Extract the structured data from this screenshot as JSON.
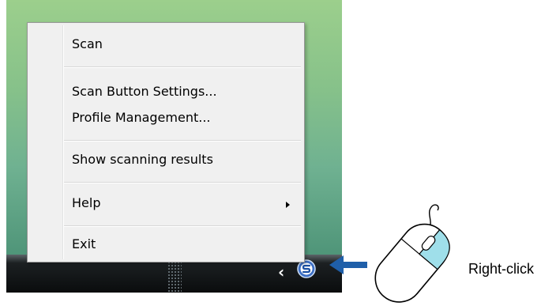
{
  "context_menu": {
    "items": [
      {
        "label": "Scan"
      },
      {
        "label": "Scan Button Settings..."
      },
      {
        "label": "Profile Management..."
      },
      {
        "label": "Show scanning results"
      },
      {
        "label": "Help",
        "has_submenu": true
      },
      {
        "label": "Exit"
      }
    ]
  },
  "taskbar": {
    "tray_icons": [
      "show-hidden-icons-chevron",
      "scansnap-manager-icon"
    ]
  },
  "annotation": {
    "label": "Right-click",
    "arrow_color": "#1f5fa9",
    "mouse_button_color": "#9fdfea"
  }
}
